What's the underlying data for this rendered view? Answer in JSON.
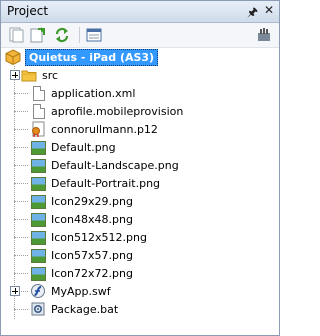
{
  "panel": {
    "title": "Project"
  },
  "tree": {
    "root_label": "Quietus - iPad (AS3)",
    "items": [
      {
        "label": "src",
        "icon": "folder-icon"
      },
      {
        "label": "application.xml",
        "icon": "file-icon"
      },
      {
        "label": "aprofile.mobileprovision",
        "icon": "file-icon"
      },
      {
        "label": "connorullmann.p12",
        "icon": "certificate-icon"
      },
      {
        "label": "Default.png",
        "icon": "image-icon"
      },
      {
        "label": "Default-Landscape.png",
        "icon": "image-icon"
      },
      {
        "label": "Default-Portrait.png",
        "icon": "image-icon"
      },
      {
        "label": "Icon29x29.png",
        "icon": "image-icon"
      },
      {
        "label": "Icon48x48.png",
        "icon": "image-icon"
      },
      {
        "label": "Icon512x512.png",
        "icon": "image-icon"
      },
      {
        "label": "Icon57x57.png",
        "icon": "image-icon"
      },
      {
        "label": "Icon72x72.png",
        "icon": "image-icon"
      },
      {
        "label": "MyApp.swf",
        "icon": "swf-icon"
      },
      {
        "label": "Package.bat",
        "icon": "batch-file-icon"
      }
    ]
  }
}
